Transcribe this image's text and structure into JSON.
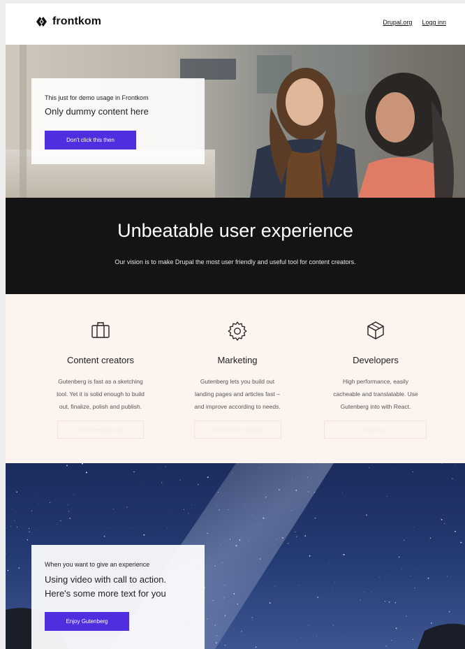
{
  "header": {
    "logo_text": "frontkom",
    "nav": [
      "Drupal.org",
      "Logg inn"
    ]
  },
  "hero": {
    "kicker": "This just for demo usage in Frontkom",
    "title": "Only dummy content here",
    "button": "Don't click this then"
  },
  "vision": {
    "title": "Unbeatable user experience",
    "text": "Our vision is to make Drupal the most user friendly and useful tool for content creators."
  },
  "features": [
    {
      "icon": "briefcase-icon",
      "title": "Content creators",
      "text": "Gutenberg is fast as a sketching\ntool. Yet it is solid enough to build\nout, finalize, polish and publish.",
      "button": "Start creating today"
    },
    {
      "icon": "gear-icon",
      "title": "Marketing",
      "text": "Gutenberg lets you build out\nlanding pages and articles fast –\nand improve according to needs.",
      "button": "Market your content"
    },
    {
      "icon": "cube-icon",
      "title": "Developers",
      "text": "High performance, easily\ncacheable and translatable. Use\nGutenberg into with React.",
      "button": "Develop"
    }
  ],
  "video_cta": {
    "kicker": "When you want to give an experience",
    "title": "Using video with call to action.\nHere's some more text for you",
    "button": "Enjoy Gutenberg"
  },
  "colors": {
    "accent": "#4f2ee0",
    "dark_band": "#141414",
    "features_bg": "#fdf4f0"
  }
}
